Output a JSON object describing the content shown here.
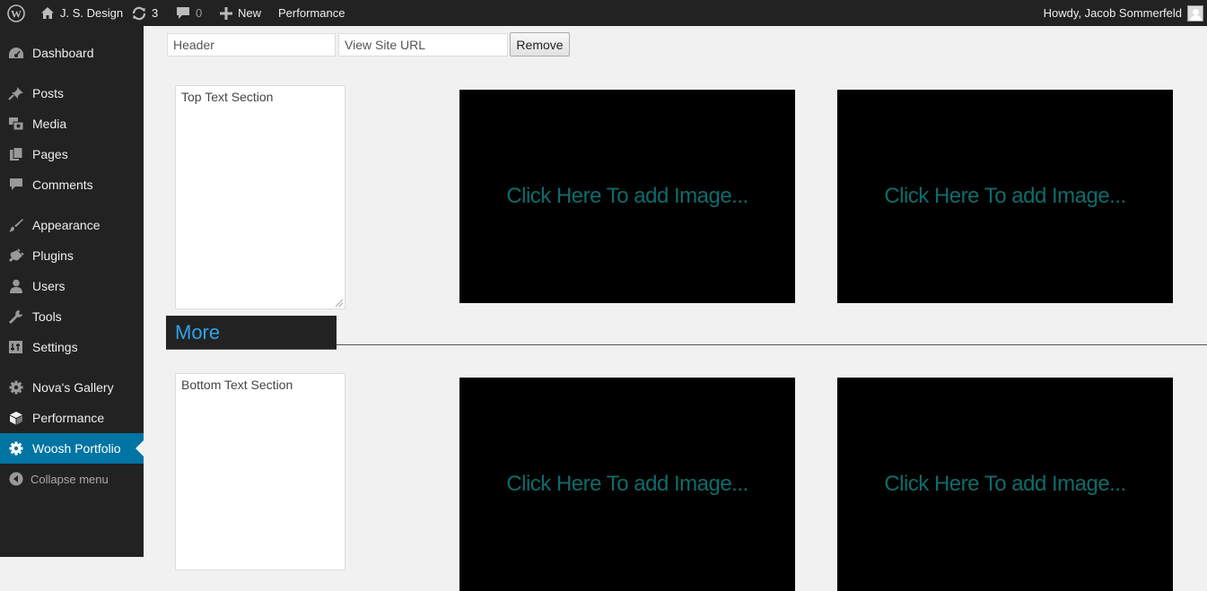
{
  "admin_bar": {
    "site_name": "J. S. Design",
    "updates_count": "3",
    "comments_count": "0",
    "new_label": "New",
    "performance_label": "Performance",
    "greeting": "Howdy, Jacob Sommerfeld"
  },
  "sidebar": {
    "items": [
      {
        "label": "Dashboard",
        "icon": "dashboard-icon"
      },
      {
        "label": "Posts",
        "icon": "pin-icon"
      },
      {
        "label": "Media",
        "icon": "media-icon"
      },
      {
        "label": "Pages",
        "icon": "pages-icon"
      },
      {
        "label": "Comments",
        "icon": "comment-icon"
      },
      {
        "label": "Appearance",
        "icon": "brush-icon"
      },
      {
        "label": "Plugins",
        "icon": "plug-icon"
      },
      {
        "label": "Users",
        "icon": "user-icon"
      },
      {
        "label": "Tools",
        "icon": "wrench-icon"
      },
      {
        "label": "Settings",
        "icon": "settings-icon"
      },
      {
        "label": "Nova's Gallery",
        "icon": "gear-icon"
      },
      {
        "label": "Performance",
        "icon": "cube-icon"
      },
      {
        "label": "Woosh Portfolio",
        "icon": "gear-icon"
      }
    ],
    "collapse_label": "Collapse menu",
    "current_item": "Woosh Portfolio",
    "accent_color": "#0074a2"
  },
  "editor": {
    "header_value": "Header",
    "view_site_url_value": "View Site URL",
    "remove_label": "Remove",
    "top_text_value": "Top Text Section",
    "bottom_text_value": "Bottom Text Section",
    "more_label": "More",
    "image_placeholder": "Click Here To add Image...",
    "image_placeholder_color": "#0f6b6b"
  }
}
